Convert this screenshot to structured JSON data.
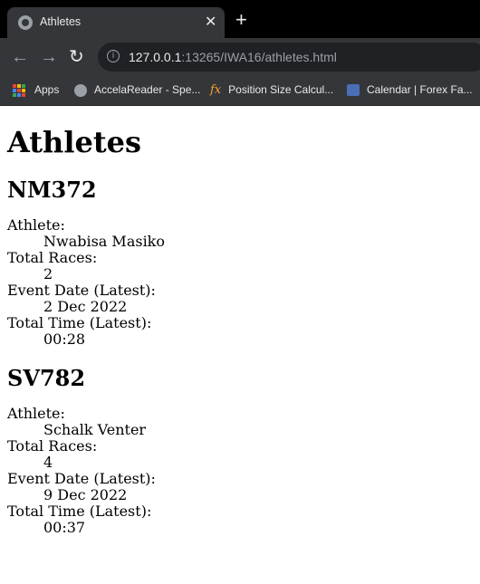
{
  "browser": {
    "tab_title": "Athletes",
    "url_host": "127.0.0.1",
    "url_rest": ":13265/IWA16/athletes.html",
    "bookmarks": [
      {
        "label": "Apps",
        "icon": "apps-grid-icon"
      },
      {
        "label": "AccelaReader - Spe...",
        "icon": "globe-icon"
      },
      {
        "label": "Position Size Calcul...",
        "icon": "fx-icon"
      },
      {
        "label": "Calendar | Forex Fa...",
        "icon": "calendar-icon"
      }
    ]
  },
  "page": {
    "heading": "Athletes",
    "athletes": [
      {
        "id": "NM372",
        "athlete_label": "Athlete:",
        "athlete": "Nwabisa Masiko",
        "races_label": "Total Races:",
        "races": "2",
        "date_label": "Event Date (Latest):",
        "date": "2 Dec 2022",
        "time_label": "Total Time (Latest):",
        "time": "00:28"
      },
      {
        "id": "SV782",
        "athlete_label": "Athlete:",
        "athlete": "Schalk Venter",
        "races_label": "Total Races:",
        "races": "4",
        "date_label": "Event Date (Latest):",
        "date": "9 Dec 2022",
        "time_label": "Total Time (Latest):",
        "time": "00:37"
      }
    ]
  }
}
